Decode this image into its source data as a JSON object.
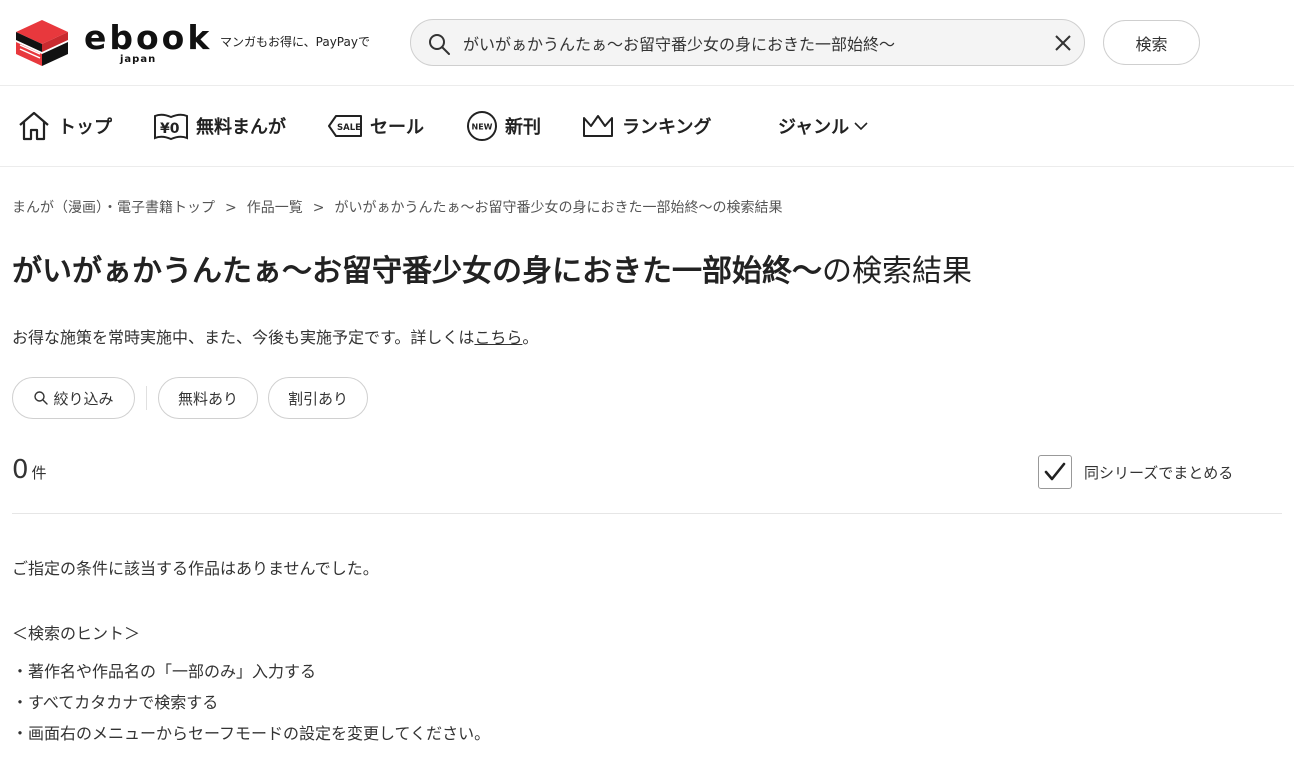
{
  "header": {
    "logo_word": "ebook",
    "logo_sub": "japan",
    "tagline": "マンガもお得に、PayPayで",
    "search": {
      "value": "がいがぁかうんたぁ～お留守番少女の身におきた一部始終～",
      "placeholder": ""
    },
    "search_button": "検索"
  },
  "nav": {
    "items": [
      {
        "label": "トップ",
        "icon": "home-icon"
      },
      {
        "label": "無料まんが",
        "icon": "free-yen-icon"
      },
      {
        "label": "セール",
        "icon": "sale-tag-icon"
      },
      {
        "label": "新刊",
        "icon": "new-badge-icon"
      },
      {
        "label": "ランキング",
        "icon": "crown-icon"
      },
      {
        "label": "ジャンル",
        "icon": "chevron-down-icon"
      }
    ]
  },
  "breadcrumb": {
    "items": [
      "まんが（漫画）・電子書籍トップ",
      "作品一覧",
      "がいがぁかうんたぁ～お留守番少女の身におきた一部始終～の検索結果"
    ],
    "separator": ">"
  },
  "title": {
    "query": "がいがぁかうんたぁ～お留守番少女の身におきた一部始終～",
    "suffix": "の検索結果"
  },
  "notice": {
    "text": "お得な施策を常時実施中、また、今後も実施予定です。詳しくは",
    "link": "こちら",
    "end": "。"
  },
  "filters": {
    "narrow": "絞り込み",
    "free": "無料あり",
    "discount": "割引あり"
  },
  "results": {
    "count": "0",
    "unit": "件",
    "series_toggle_label": "同シリーズでまとめる",
    "series_toggle_checked": true
  },
  "empty": {
    "message": "ご指定の条件に該当する作品はありませんでした。",
    "hint_title": "＜検索のヒント＞",
    "hints": [
      "・著作名や作品名の「一部のみ」入力する",
      "・すべてカタカナで検索する",
      "・画面右のメニューからセーフモードの設定を変更してください。"
    ]
  },
  "colors": {
    "brand_red": "#e8383d",
    "text": "#333333",
    "border": "#d0d0d0"
  }
}
